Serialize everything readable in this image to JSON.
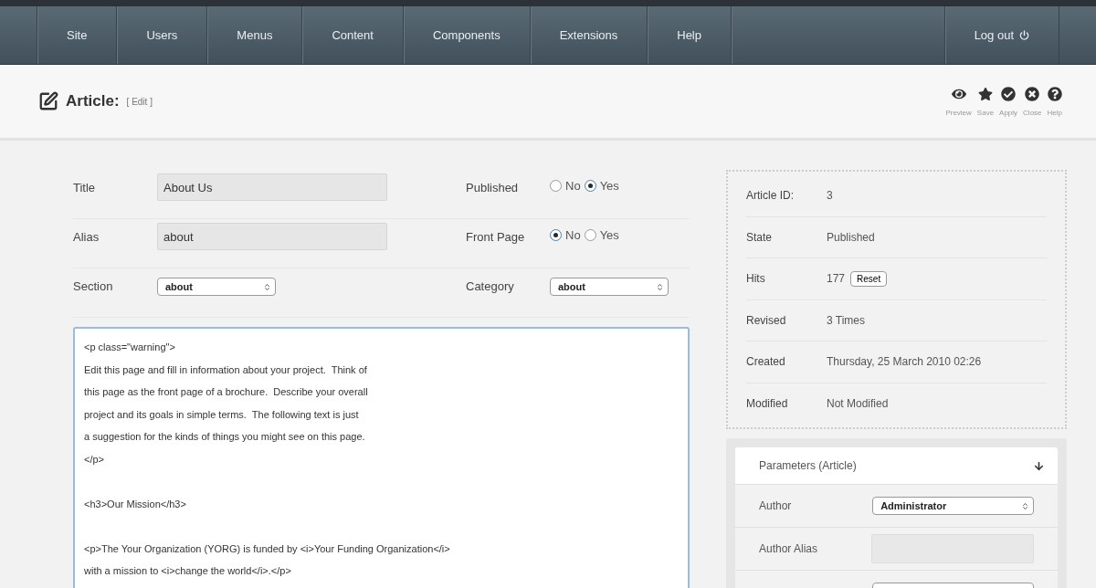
{
  "nav": {
    "items": [
      {
        "label": "Site"
      },
      {
        "label": "Users"
      },
      {
        "label": "Menus"
      },
      {
        "label": "Content"
      },
      {
        "label": "Components"
      },
      {
        "label": "Extensions"
      },
      {
        "label": "Help"
      }
    ],
    "logout": "Log out"
  },
  "header": {
    "title": "Article:",
    "subtitle": "[ Edit ]",
    "toolbar": [
      {
        "kind": "preview",
        "label": "Preview"
      },
      {
        "kind": "save",
        "label": "Save"
      },
      {
        "kind": "apply",
        "label": "Apply"
      },
      {
        "kind": "close",
        "label": "Close"
      },
      {
        "kind": "help",
        "label": "Help"
      }
    ]
  },
  "form": {
    "title": {
      "label": "Title",
      "value": "About Us"
    },
    "alias": {
      "label": "Alias",
      "value": "about"
    },
    "section": {
      "label": "Section",
      "value": "about"
    },
    "published": {
      "label": "Published",
      "options": [
        {
          "label": "No",
          "selected": false
        },
        {
          "label": "Yes",
          "selected": true
        }
      ]
    },
    "front_page": {
      "label": "Front Page",
      "options": [
        {
          "label": "No",
          "selected": true
        },
        {
          "label": "Yes",
          "selected": false
        }
      ]
    },
    "category": {
      "label": "Category",
      "value": "about"
    }
  },
  "editor": {
    "blocks": [
      [
        "<p class=\"warning\">",
        "Edit this page and fill in information about your project.  Think of",
        "this page as the front page of a brochure.  Describe your overall",
        "project and its goals in simple terms.  The following text is just",
        "a suggestion for the kinds of things you might see on this page.",
        "</p>"
      ],
      [
        "<h3>Our Mission</h3>"
      ],
      [
        "<p>The Your Organization (YORG) is funded by <i>Your Funding Organization</i>",
        "with a mission to <i>change the world</i>.</p>"
      ]
    ]
  },
  "info": [
    {
      "label": "Article ID:",
      "value": "3"
    },
    {
      "label": "State",
      "value": "Published"
    },
    {
      "label": "Hits",
      "value": "177",
      "button": "Reset"
    },
    {
      "label": "Revised",
      "value": "3 Times"
    },
    {
      "label": "Created",
      "value": "Thursday, 25 March 2010 02:26"
    },
    {
      "label": "Modified",
      "value": "Not Modified"
    }
  ],
  "parameters": {
    "title": "Parameters (Article)",
    "rows": [
      {
        "kind": "select",
        "label": "Author",
        "value": "Administrator"
      },
      {
        "kind": "text",
        "label": "Author Alias"
      },
      {
        "kind": "select"
      }
    ]
  }
}
